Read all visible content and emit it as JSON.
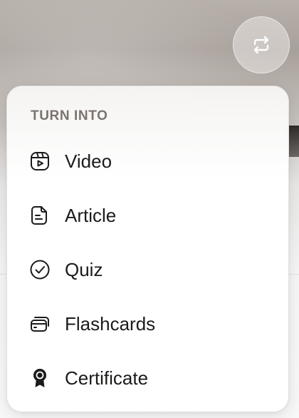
{
  "menu": {
    "heading": "TURN INTO",
    "items": [
      {
        "label": "Video",
        "icon": "video-icon"
      },
      {
        "label": "Article",
        "icon": "article-icon"
      },
      {
        "label": "Quiz",
        "icon": "quiz-check-icon"
      },
      {
        "label": "Flashcards",
        "icon": "flashcards-icon"
      },
      {
        "label": "Certificate",
        "icon": "certificate-icon"
      }
    ]
  },
  "fab": {
    "icon": "repeat-icon"
  },
  "colors": {
    "heading": "#7a746f",
    "label": "#1c1b1a",
    "menu_background": "#ffffff"
  }
}
